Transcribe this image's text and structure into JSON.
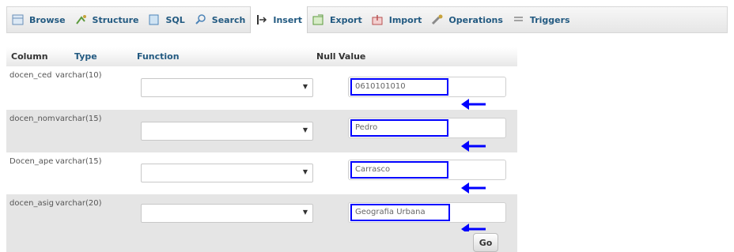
{
  "tabs": [
    {
      "label": "Browse",
      "icon": "browse-icon"
    },
    {
      "label": "Structure",
      "icon": "structure-icon"
    },
    {
      "label": "SQL",
      "icon": "sql-icon"
    },
    {
      "label": "Search",
      "icon": "search-icon"
    },
    {
      "label": "Insert",
      "icon": "insert-icon",
      "active": true
    },
    {
      "label": "Export",
      "icon": "export-icon"
    },
    {
      "label": "Import",
      "icon": "import-icon"
    },
    {
      "label": "Operations",
      "icon": "operations-icon"
    },
    {
      "label": "Triggers",
      "icon": "triggers-icon"
    }
  ],
  "table": {
    "headers": {
      "column": "Column",
      "type": "Type",
      "function": "Function",
      "null": "Null",
      "value": "Value"
    },
    "rows": [
      {
        "column": "docen_ced",
        "type": "varchar(10)",
        "value": "0610101010"
      },
      {
        "column": "docen_nom",
        "type": "varchar(15)",
        "value": "Pedro"
      },
      {
        "column": "Docen_ape",
        "type": "varchar(15)",
        "value": "Carrasco"
      },
      {
        "column": "docen_asig",
        "type": "varchar(20)",
        "value": "Geografia Urbana"
      }
    ]
  },
  "go_label": "Go",
  "colors": {
    "annotation": "#0000ff",
    "link": "#235a81",
    "row_shade": "#e5e5e5"
  }
}
